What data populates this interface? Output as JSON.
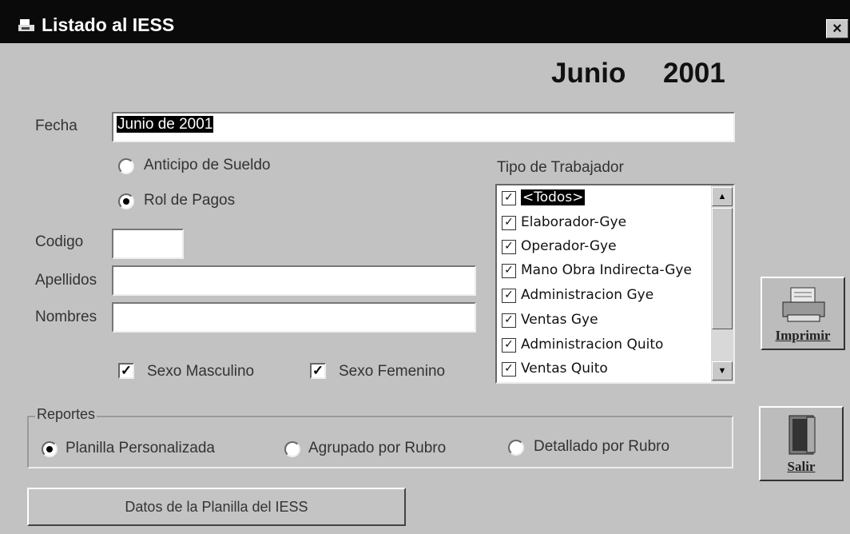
{
  "window": {
    "title": "Listado al IESS",
    "close_label": "×"
  },
  "period": {
    "month": "Junio",
    "year": "2001"
  },
  "fecha": {
    "label": "Fecha",
    "value": "Junio de 2001"
  },
  "tipo_pago": {
    "anticipo_label": "Anticipo de Sueldo",
    "rol_label": "Rol de Pagos",
    "selected": "rol"
  },
  "codigo": {
    "label": "Codigo",
    "value": ""
  },
  "apellidos": {
    "label": "Apellidos",
    "value": ""
  },
  "nombres": {
    "label": "Nombres",
    "value": ""
  },
  "sexo": {
    "masculino_label": "Sexo Masculino",
    "femenino_label": "Sexo Femenino",
    "masculino_checked": true,
    "femenino_checked": true
  },
  "tipo_trabajador": {
    "label": "Tipo de Trabajador",
    "items": [
      {
        "label": "<Todos>",
        "checked": true,
        "highlighted": true
      },
      {
        "label": "Elaborador-Gye",
        "checked": true
      },
      {
        "label": "Operador-Gye",
        "checked": true
      },
      {
        "label": "Mano Obra Indirecta-Gye",
        "checked": true
      },
      {
        "label": "Administracion Gye",
        "checked": true
      },
      {
        "label": "Ventas Gye",
        "checked": true
      },
      {
        "label": "Administracion  Quito",
        "checked": true
      },
      {
        "label": "Ventas  Quito",
        "checked": true
      }
    ]
  },
  "buttons": {
    "imprimir": "Imprimir",
    "salir": "Salir",
    "datos": "Datos de la Planilla del IESS"
  },
  "reportes": {
    "title": "Reportes",
    "options": [
      {
        "label": "Planilla Personalizada",
        "selected": true
      },
      {
        "label": "Agrupado por Rubro",
        "selected": false
      },
      {
        "label": "Detallado por Rubro",
        "selected": false
      }
    ]
  },
  "check_glyph": "✓"
}
